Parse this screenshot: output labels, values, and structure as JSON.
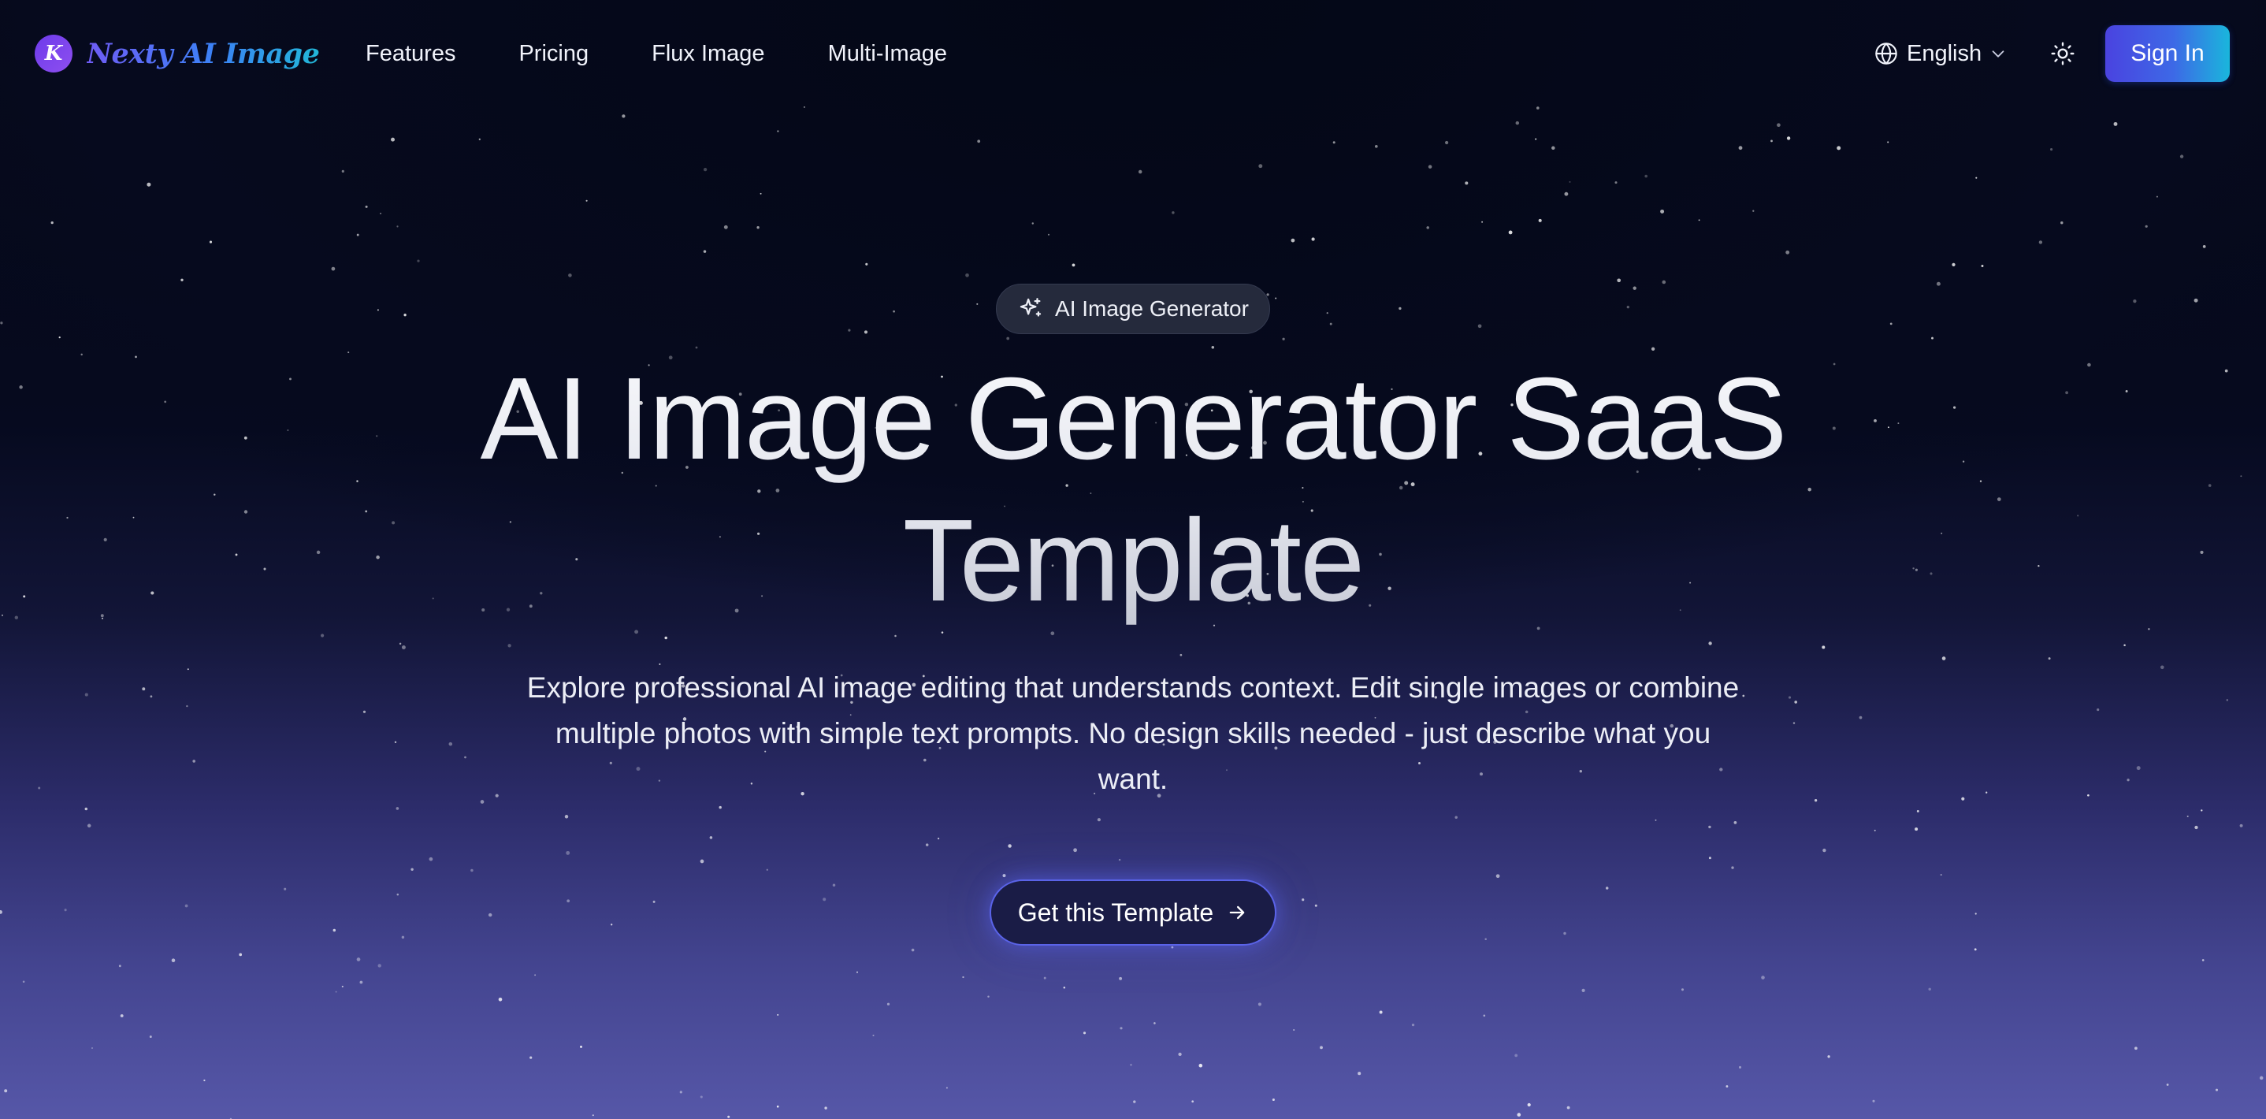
{
  "brand": {
    "logo_letter": "K",
    "name": "Nexty AI Image"
  },
  "nav": {
    "links": [
      "Features",
      "Pricing",
      "Flux Image",
      "Multi-Image"
    ],
    "language": "English",
    "sign_in_label": "Sign In"
  },
  "hero": {
    "badge_label": "AI Image Generator",
    "title": "AI Image Generator SaaS Template",
    "description": "Explore professional AI image editing that understands context. Edit single images or combine multiple photos with simple text prompts. No design skills needed - just describe what you want.",
    "cta_label": "Get this Template"
  },
  "icons": {
    "logo": "k-logo-icon",
    "language": "globe-icon",
    "language_dropdown": "chevron-down-icon",
    "theme": "sun-icon",
    "badge": "sparkles-icon",
    "cta": "arrow-right-icon"
  },
  "colors": {
    "background_top": "#040716",
    "background_bottom": "#5657a8",
    "accent_start": "#4a43e0",
    "accent_end": "#1ab6dc",
    "logo_purple": "#6d3bea"
  }
}
